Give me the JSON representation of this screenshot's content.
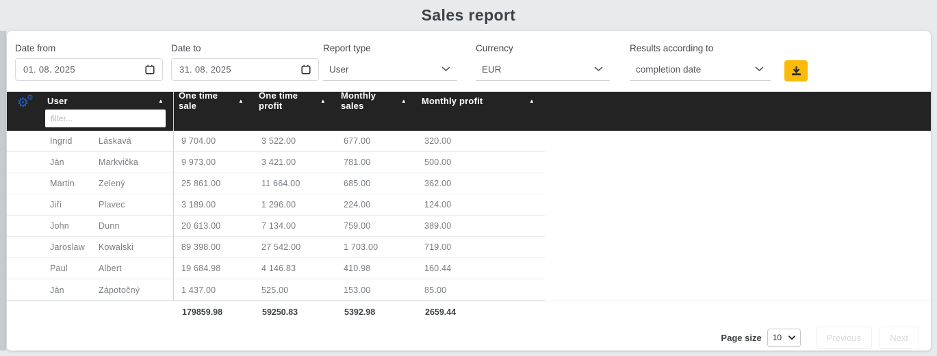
{
  "title": "Sales report",
  "icons": {
    "gear": "⚙",
    "sort_asc": "▲"
  },
  "filters": {
    "date_from": {
      "label": "Date from",
      "value": "01. 08. 2025"
    },
    "date_to": {
      "label": "Date to",
      "value": "31. 08. 2025"
    },
    "report_type": {
      "label": "Report type",
      "value": "User"
    },
    "currency": {
      "label": "Currency",
      "value": "EUR"
    },
    "results_according_to": {
      "label": "Results according to",
      "value": "completion date"
    }
  },
  "table": {
    "columns": [
      "User",
      "One time sale",
      "One time profit",
      "Monthly sales",
      "Monthly profit"
    ],
    "filter_placeholder": "filter...",
    "rows": [
      {
        "first": "Ingrid",
        "last": "Láskavá",
        "one_time_sale": "9 704.00",
        "one_time_profit": "3 522.00",
        "monthly_sales": "677.00",
        "monthly_profit": "320.00"
      },
      {
        "first": "Ján",
        "last": "Markvička",
        "one_time_sale": "9 973.00",
        "one_time_profit": "3 421.00",
        "monthly_sales": "781.00",
        "monthly_profit": "500.00"
      },
      {
        "first": "Martin",
        "last": "Zelený",
        "one_time_sale": "25 861.00",
        "one_time_profit": "11 664.00",
        "monthly_sales": "685.00",
        "monthly_profit": "362.00"
      },
      {
        "first": "Jiří",
        "last": "Plavec",
        "one_time_sale": "3 189.00",
        "one_time_profit": "1 296.00",
        "monthly_sales": "224.00",
        "monthly_profit": "124.00"
      },
      {
        "first": "John",
        "last": "Dunn",
        "one_time_sale": "20 613.00",
        "one_time_profit": "7 134.00",
        "monthly_sales": "759.00",
        "monthly_profit": "389.00"
      },
      {
        "first": "Jaroslaw",
        "last": "Kowalski",
        "one_time_sale": "89 398.00",
        "one_time_profit": "27 542.00",
        "monthly_sales": "1 703.00",
        "monthly_profit": "719.00"
      },
      {
        "first": "Paul",
        "last": "Albert",
        "one_time_sale": "19 684.98",
        "one_time_profit": "4 146.83",
        "monthly_sales": "410.98",
        "monthly_profit": "160.44"
      },
      {
        "first": "Ján",
        "last": "Zápotočný",
        "one_time_sale": "1 437.00",
        "one_time_profit": "525.00",
        "monthly_sales": "153.00",
        "monthly_profit": "85.00"
      }
    ],
    "totals": {
      "one_time_sale": "179859.98",
      "one_time_profit": "59250.83",
      "monthly_sales": "5392.98",
      "monthly_profit": "2659.44"
    }
  },
  "pagination": {
    "page_size_label": "Page size",
    "page_size": "10",
    "previous_label": "Previous",
    "next_label": "Next"
  }
}
